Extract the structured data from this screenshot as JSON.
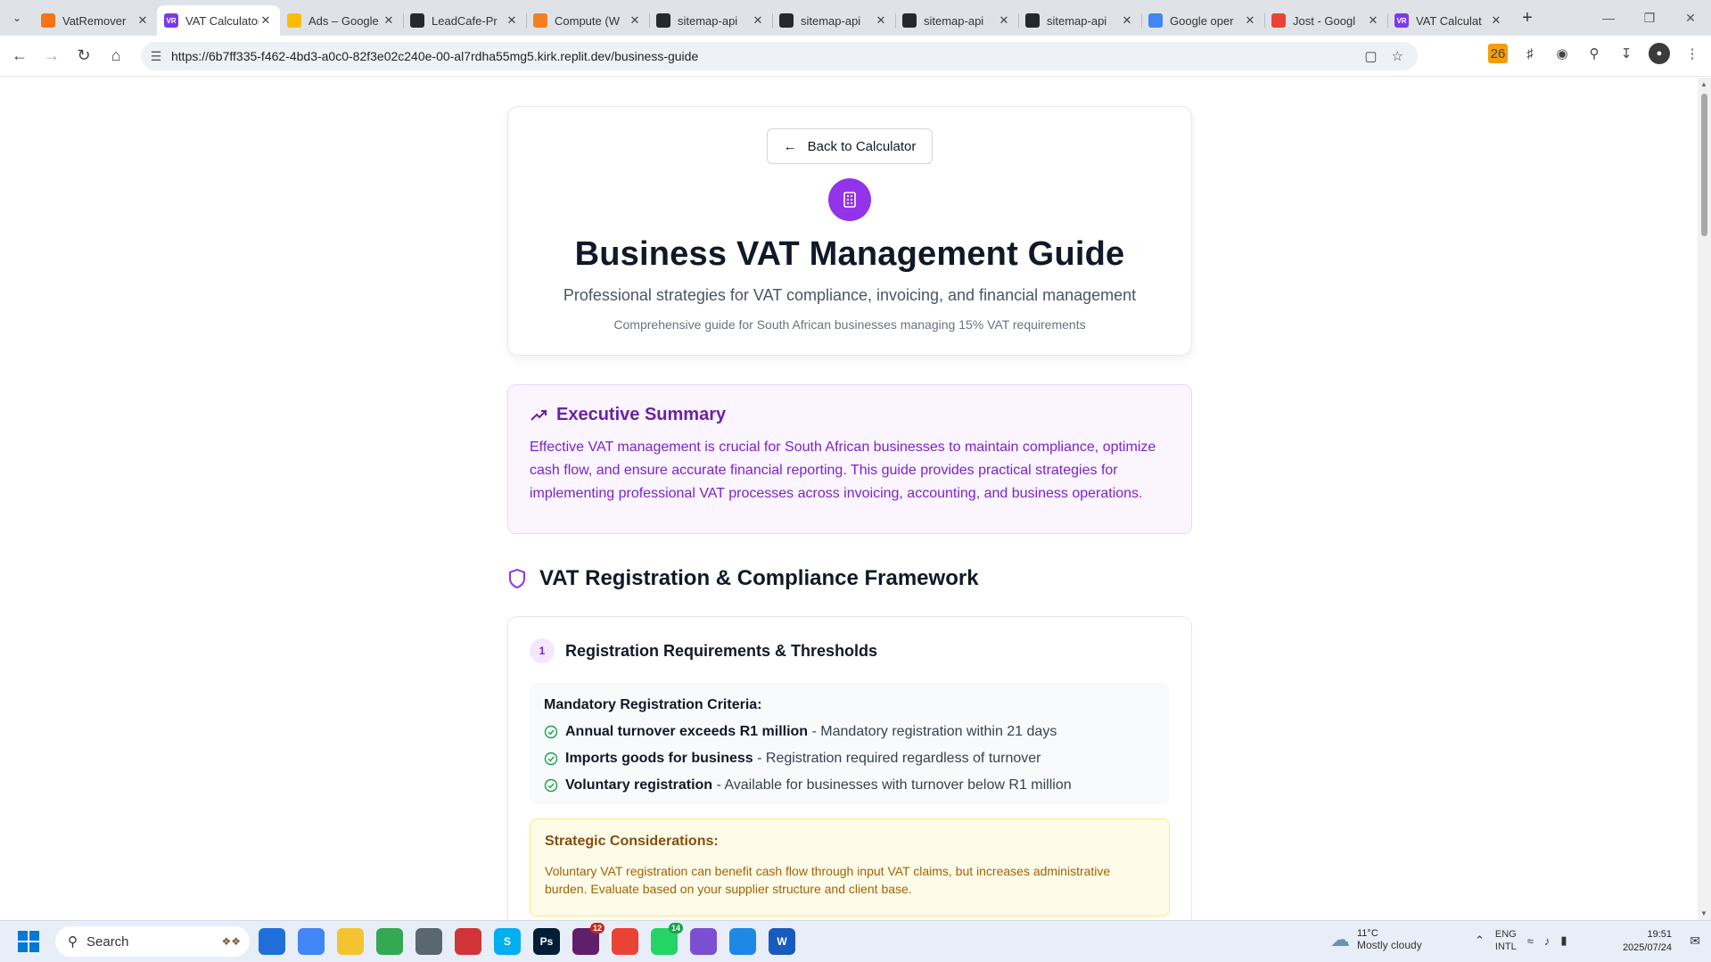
{
  "browser": {
    "tabs": [
      {
        "title": "VatRemover",
        "icon": "vatremover-favicon",
        "color": "#f97316",
        "active": false
      },
      {
        "title": "VAT Calculator",
        "icon": "vr-favicon",
        "color": "#7c3aed",
        "active": true
      },
      {
        "title": "Ads – Google",
        "icon": "google-ads-favicon",
        "color": "#fbbc04",
        "active": false
      },
      {
        "title": "LeadCafe-Pr",
        "icon": "github-favicon",
        "color": "#24292f",
        "active": false
      },
      {
        "title": "Compute (W",
        "icon": "cloudflare-favicon",
        "color": "#f38020",
        "active": false
      },
      {
        "title": "sitemap-api",
        "icon": "github-favicon",
        "color": "#24292f",
        "active": false
      },
      {
        "title": "sitemap-api",
        "icon": "github-favicon",
        "color": "#24292f",
        "active": false
      },
      {
        "title": "sitemap-api",
        "icon": "github-favicon",
        "color": "#24292f",
        "active": false
      },
      {
        "title": "sitemap-api",
        "icon": "github-favicon",
        "color": "#24292f",
        "active": false
      },
      {
        "title": "Google oper",
        "icon": "google-favicon",
        "color": "#4285f4",
        "active": false
      },
      {
        "title": "Jost - Googl",
        "icon": "google-fonts-favicon",
        "color": "#ea4335",
        "active": false
      },
      {
        "title": "VAT Calculat",
        "icon": "vr-favicon",
        "color": "#7c3aed",
        "active": false
      }
    ],
    "favicon_text": "VR",
    "url": "https://6b7ff335-f462-4bd3-a0c0-82f3e02c240e-00-al7rdha55mg5.kirk.replit.dev/business-guide",
    "extension_badge": "26"
  },
  "page": {
    "back_label": "Back to Calculator",
    "title": "Business VAT Management Guide",
    "subtitle": "Professional strategies for VAT compliance, invoicing, and financial management",
    "note": "Comprehensive guide for South African businesses managing 15% VAT requirements",
    "summary": {
      "heading": "Executive Summary",
      "text": "Effective VAT management is crucial for South African businesses to maintain compliance, optimize cash flow, and ensure accurate financial reporting. This guide provides practical strategies for implementing professional VAT processes across invoicing, accounting, and business operations."
    },
    "section": {
      "heading": "VAT Registration & Compliance Framework",
      "step_number": "1",
      "step_title": "Registration Requirements & Thresholds",
      "criteria_title": "Mandatory Registration Criteria:",
      "criteria": [
        {
          "bold": "Annual turnover exceeds R1 million",
          "text": " - Mandatory registration within 21 days"
        },
        {
          "bold": "Imports goods for business",
          "text": " - Registration required regardless of turnover"
        },
        {
          "bold": "Voluntary registration",
          "text": " - Available for businesses with turnover below R1 million"
        }
      ],
      "strategic_title": "Strategic Considerations:",
      "strategic_text": "Voluntary VAT registration can benefit cash flow through input VAT claims, but increases administrative burden. Evaluate based on your supplier structure and client base."
    }
  },
  "taskbar": {
    "search_placeholder": "Search",
    "apps": [
      {
        "name": "edge-app",
        "color": "#1e6fd9",
        "label": ""
      },
      {
        "name": "google-ads-app",
        "color": "#4285f4",
        "label": ""
      },
      {
        "name": "file-explorer-app",
        "color": "#f4c430",
        "label": ""
      },
      {
        "name": "google-drive-app",
        "color": "#34a853",
        "label": ""
      },
      {
        "name": "calculator-app",
        "color": "#5b6770",
        "label": ""
      },
      {
        "name": "snipping-tool-app",
        "color": "#d13438",
        "label": ""
      },
      {
        "name": "skype-app",
        "color": "#00aff0",
        "label": "S"
      },
      {
        "name": "photoshop-app",
        "color": "#001e36",
        "label": "Ps"
      },
      {
        "name": "slack-app",
        "color": "#611f69",
        "label": "",
        "badge": "12"
      },
      {
        "name": "chrome-app",
        "color": "#ea4335",
        "label": ""
      },
      {
        "name": "whatsapp-app",
        "color": "#25d366",
        "label": "",
        "badge": "14"
      },
      {
        "name": "visual-studio-app",
        "color": "#7b4fd1",
        "label": ""
      },
      {
        "name": "notepad-app",
        "color": "#1e88e5",
        "label": ""
      },
      {
        "name": "word-app",
        "color": "#185abd",
        "label": "W"
      }
    ],
    "weather_temp": "11°C",
    "weather_condition": "Mostly cloudy",
    "lang_1": "ENG",
    "lang_2": "INTL",
    "time": "19:51",
    "date": "2025/07/24"
  }
}
